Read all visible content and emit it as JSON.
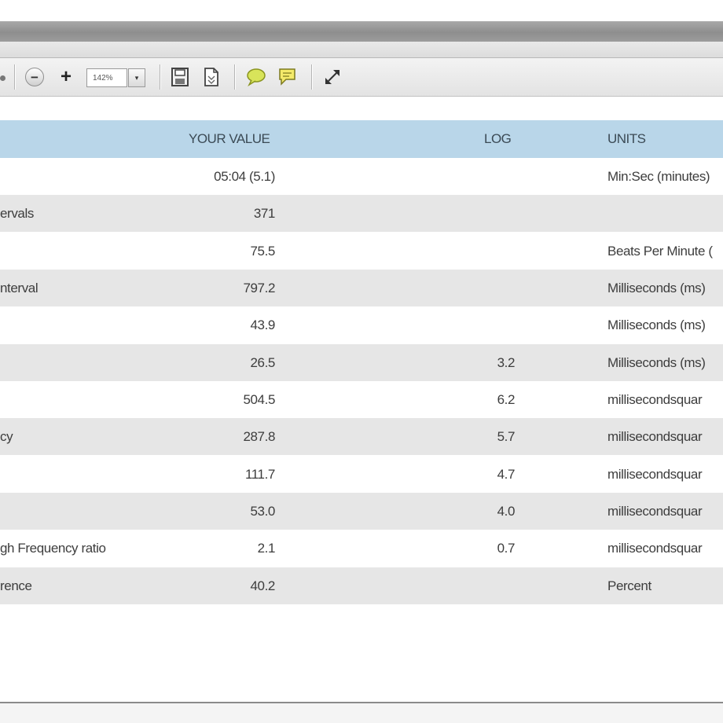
{
  "toolbar": {
    "zoom_value": "142%",
    "zoom_dropdown_glyph": "▾",
    "zoom_out_glyph": "−",
    "zoom_in_glyph": "+",
    "icons": [
      "zoom-out-icon",
      "zoom-in-icon",
      "save-icon",
      "page-icon",
      "comment-icon",
      "sticky-note-icon",
      "expand-icon"
    ]
  },
  "table": {
    "headers": {
      "value": "YOUR VALUE",
      "log": "LOG",
      "units": "UNITS"
    },
    "rows": [
      {
        "name": "",
        "value": "05:04 (5.1)",
        "log": "",
        "units": "Min:Sec (minutes)"
      },
      {
        "name": "ervals",
        "value": "371",
        "log": "",
        "units": ""
      },
      {
        "name": "",
        "value": "75.5",
        "log": "",
        "units": "Beats Per Minute ("
      },
      {
        "name": "nterval",
        "value": "797.2",
        "log": "",
        "units": "Milliseconds (ms)"
      },
      {
        "name": "",
        "value": "43.9",
        "log": "",
        "units": "Milliseconds (ms)"
      },
      {
        "name": "",
        "value": "26.5",
        "log": "3.2",
        "units": "Milliseconds (ms)"
      },
      {
        "name": "",
        "value": "504.5",
        "log": "6.2",
        "units": "millisecondsquar"
      },
      {
        "name": "cy",
        "value": "287.8",
        "log": "5.7",
        "units": "millisecondsquar"
      },
      {
        "name": "",
        "value": "111.7",
        "log": "4.7",
        "units": "millisecondsquar"
      },
      {
        "name": "",
        "value": "53.0",
        "log": "4.0",
        "units": "millisecondsquar"
      },
      {
        "name": "gh Frequency ratio",
        "value": "2.1",
        "log": "0.7",
        "units": "millisecondsquar"
      },
      {
        "name": "rence",
        "value": "40.2",
        "log": "",
        "units": "Percent"
      }
    ]
  },
  "colors": {
    "header_bg": "#b9d6e9",
    "alt_row_bg": "#e6e6e6",
    "comment_icon": "#c8d83a"
  }
}
